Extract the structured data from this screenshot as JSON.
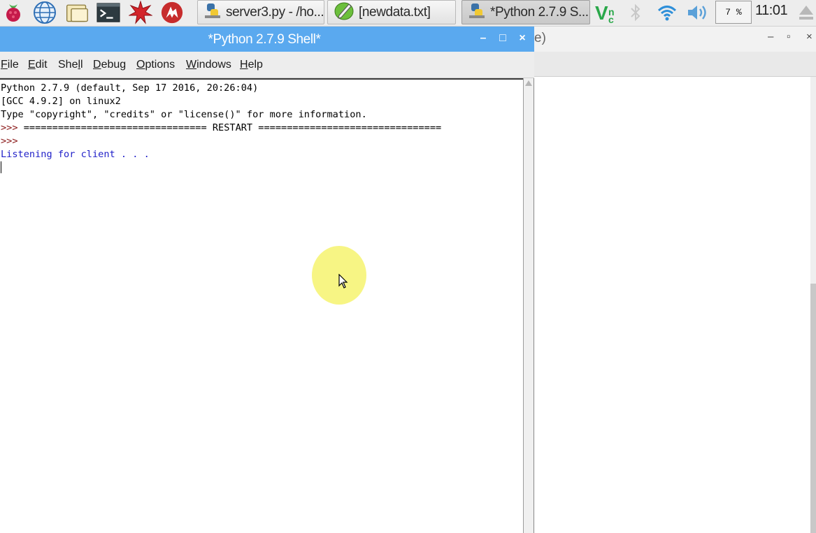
{
  "taskbar": {
    "launchers": [
      {
        "icon": "raspberry-menu-icon"
      },
      {
        "icon": "web-browser-icon"
      },
      {
        "icon": "file-manager-icon"
      },
      {
        "icon": "terminal-icon"
      },
      {
        "icon": "mathematica-icon"
      },
      {
        "icon": "wolfram-icon"
      }
    ],
    "tasks": [
      {
        "label": "server3.py - /ho...",
        "icon": "python-file-icon",
        "active": false
      },
      {
        "label": "[newdata.txt]",
        "icon": "text-editor-icon",
        "active": false
      },
      {
        "label": "*Python 2.7.9 S...",
        "icon": "python-shell-icon",
        "active": true
      }
    ],
    "tray": {
      "vnc_icon": "vnc-icon",
      "bluetooth_icon": "bluetooth-icon",
      "wifi_icon": "wifi-icon",
      "volume_icon": "volume-icon",
      "cpu_usage": "7 %",
      "clock": "11:01",
      "eject_icon": "eject-icon"
    }
  },
  "background_window": {
    "title_fragment": "e)",
    "controls": {
      "minimize": "–",
      "restore": "▫",
      "close": "×"
    }
  },
  "shell": {
    "title": "*Python 2.7.9 Shell*",
    "controls": {
      "minimize": "–",
      "maximize": "□",
      "close": "×"
    },
    "menu": [
      {
        "label": "File",
        "u": "F",
        "rest": "ile"
      },
      {
        "label": "Edit",
        "u": "E",
        "rest": "dit"
      },
      {
        "label": "Shell",
        "pre": "She",
        "u": "l",
        "rest": "l"
      },
      {
        "label": "Debug",
        "u": "D",
        "rest": "ebug"
      },
      {
        "label": "Options",
        "u": "O",
        "rest": "ptions"
      },
      {
        "label": "Windows",
        "u": "W",
        "rest": "indows"
      },
      {
        "label": "Help",
        "u": "H",
        "rest": "elp"
      }
    ],
    "lines": [
      {
        "text": "Python 2.7.9 (default, Sep 17 2016, 20:26:04)",
        "kind": "out"
      },
      {
        "text": "[GCC 4.9.2] on linux2",
        "kind": "out"
      },
      {
        "text": "Type \"copyright\", \"credits\" or \"license()\" for more information.",
        "kind": "out"
      },
      {
        "prompt": ">>> ",
        "text": "================================ RESTART ================================",
        "kind": "restart"
      },
      {
        "prompt": ">>> ",
        "text": "",
        "kind": "prompt"
      },
      {
        "text": "Listening for client . . .",
        "kind": "stdout"
      }
    ]
  }
}
